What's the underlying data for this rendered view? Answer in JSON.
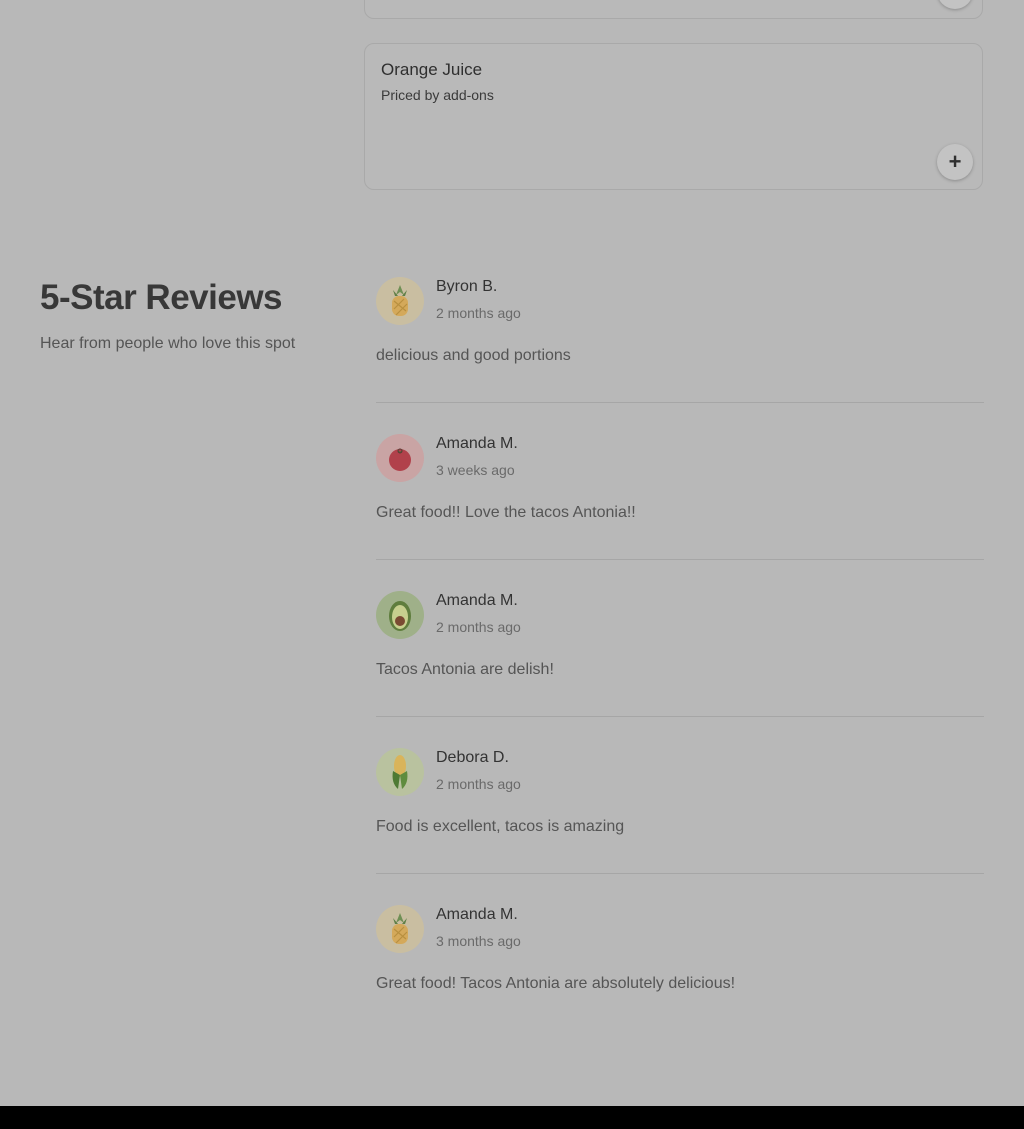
{
  "menu": {
    "item": {
      "name": "Orange Juice",
      "subtitle": "Priced by add-ons",
      "add_label": "+"
    },
    "prev_add_label": "+"
  },
  "reviews_section": {
    "title": "5-Star Reviews",
    "subtitle": "Hear from people who love this spot",
    "reviews": [
      {
        "name": "Byron B.",
        "time": "2 months ago",
        "text": "delicious and good portions",
        "avatar_icon": "pineapple-icon"
      },
      {
        "name": "Amanda M.",
        "time": "3 weeks ago",
        "text": "Great food!! Love the tacos Antonia!!",
        "avatar_icon": "tomato-icon"
      },
      {
        "name": "Amanda M.",
        "time": "2 months ago",
        "text": "Tacos Antonia are delish!",
        "avatar_icon": "avocado-icon"
      },
      {
        "name": "Debora D.",
        "time": "2 months ago",
        "text": "Food is excellent, tacos is amazing",
        "avatar_icon": "corn-icon"
      },
      {
        "name": "Amanda M.",
        "time": "3 months ago",
        "text": "Great food! Tacos Antonia are absolutely delicious!",
        "avatar_icon": "pineapple-icon"
      }
    ]
  },
  "colors": {
    "overlay_bg": "#b8b8b8",
    "pineapple_bg": "#c9bea1",
    "tomato_bg": "#c9a4a4",
    "avocado_bg": "#9fb089",
    "corn_bg": "#b9c29f"
  }
}
